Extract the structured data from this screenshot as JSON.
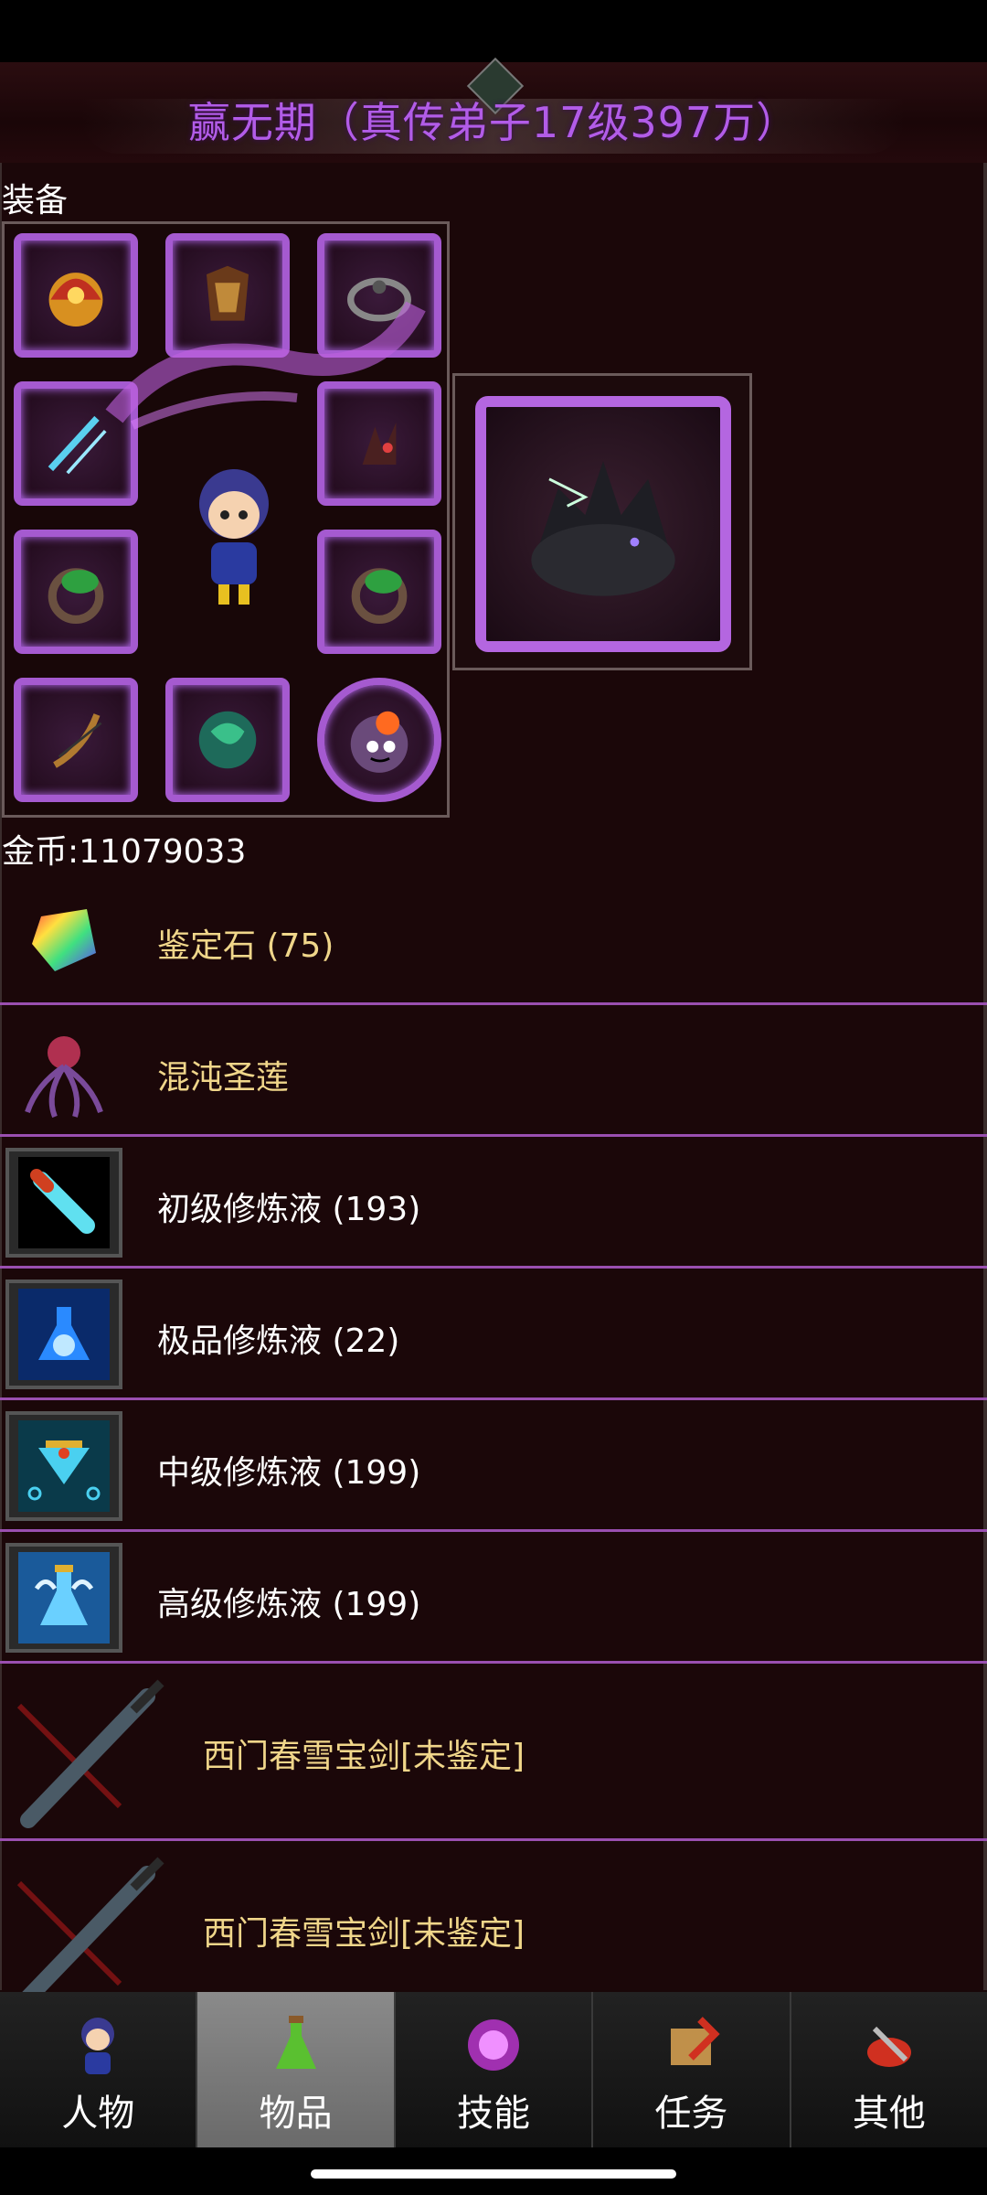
{
  "title": "赢无期（真传弟子17级397万）",
  "equipment": {
    "label": "装备",
    "slots": [
      {
        "icon": "helmet-icon",
        "color": "#e0a020"
      },
      {
        "icon": "armor-icon",
        "color": "#8a4a20"
      },
      {
        "icon": "belt-icon",
        "color": "#666a70"
      },
      {
        "icon": "sword-icon",
        "color": "#4ac0e8"
      },
      {
        "icon": "claw-icon",
        "color": "#5a2a2a"
      },
      {
        "icon": "ring-icon",
        "color": "#3aa04a"
      },
      {
        "icon": "ring-icon",
        "color": "#3aa04a"
      },
      {
        "icon": "bow-icon",
        "color": "#8a5a2a"
      },
      {
        "icon": "beast-charm-icon",
        "color": "#2a8a6a"
      },
      {
        "icon": "ghost-orb-icon",
        "color": "#d03a2a"
      }
    ],
    "pet_icon": "dark-wolf-icon"
  },
  "gold": "金币:11079033",
  "items": [
    {
      "name": "鉴定石 (75)",
      "icon": "rainbow-gem-icon",
      "text_color": "gold",
      "boxed": false
    },
    {
      "name": "混沌圣莲",
      "icon": "chaos-lotus-icon",
      "text_color": "gold",
      "boxed": false
    },
    {
      "name": "初级修炼液 (193)",
      "icon": "vial-icon",
      "text_color": "white",
      "boxed": true
    },
    {
      "name": "极品修炼液 (22)",
      "icon": "flask-icon",
      "text_color": "white",
      "boxed": true
    },
    {
      "name": "中级修炼液 (199)",
      "icon": "goblet-icon",
      "text_color": "white",
      "boxed": true
    },
    {
      "name": "高级修炼液 (199)",
      "icon": "winged-flask-icon",
      "text_color": "white",
      "boxed": true
    },
    {
      "name": "西门春雪宝剑[未鉴定]",
      "icon": "broadsword-icon",
      "text_color": "gold",
      "boxed": false
    },
    {
      "name": "西门春雪宝剑[未鉴定]",
      "icon": "broadsword-icon",
      "text_color": "gold",
      "boxed": false
    }
  ],
  "tabs": [
    {
      "label": "人物",
      "icon": "character-icon",
      "active": false
    },
    {
      "label": "物品",
      "icon": "potion-icon",
      "active": true
    },
    {
      "label": "技能",
      "icon": "skill-orb-icon",
      "active": false
    },
    {
      "label": "任务",
      "icon": "quest-icon",
      "active": false
    },
    {
      "label": "其他",
      "icon": "other-icon",
      "active": false
    }
  ],
  "colors": {
    "title": "#b25ce8",
    "item_gold": "#f0d68a",
    "divider": "#9a4fb0",
    "slot_border": "#a55ad0"
  }
}
